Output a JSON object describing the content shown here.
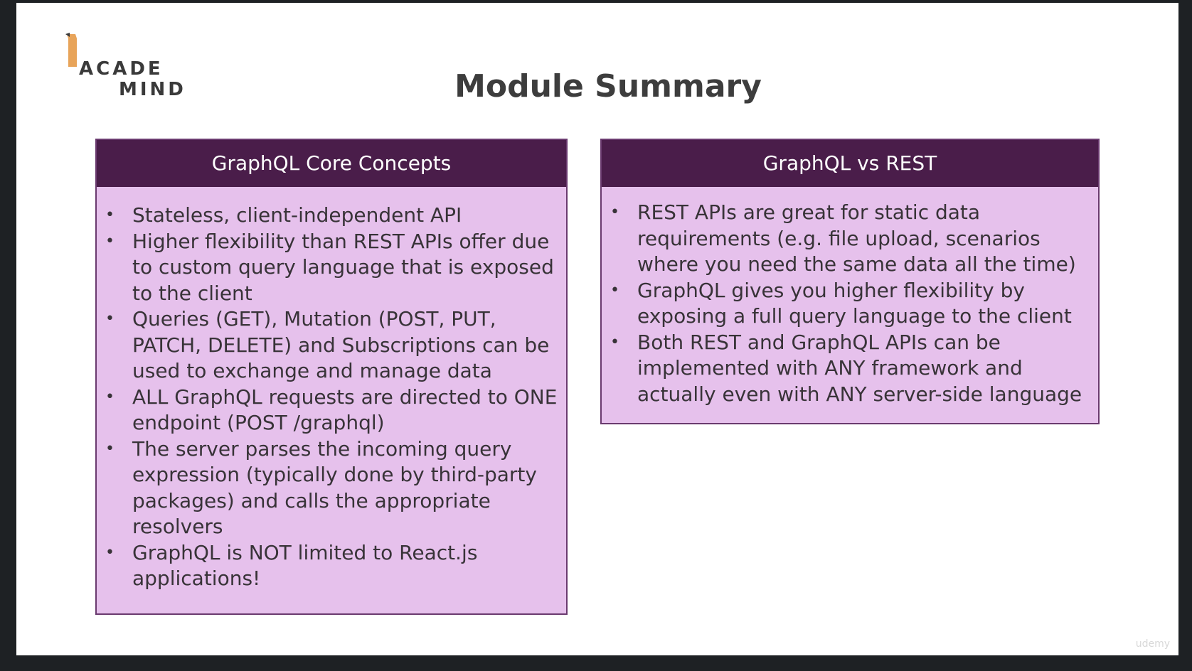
{
  "logo": {
    "line1": "ACADE",
    "line2": "MIND",
    "accent_color": "#e8a45a"
  },
  "slide": {
    "title": "Module Summary"
  },
  "cards": {
    "left": {
      "header": "GraphQL Core Concepts",
      "items": [
        "Stateless, client-independent API",
        "Higher flexibility than REST APIs offer due to custom query language that is exposed to the client",
        "Queries (GET), Mutation (POST, PUT, PATCH, DELETE) and Subscriptions can be used to exchange and manage data",
        "ALL GraphQL requests are directed to ONE endpoint (POST /graphql)",
        "The server parses the incoming query expression (typically done by third-party packages) and calls the appropriate resolvers",
        "GraphQL is NOT limited to React.js applications!"
      ]
    },
    "right": {
      "header": "GraphQL vs REST",
      "items": [
        "REST APIs are great for static data requirements (e.g. file upload, scenarios where you need the same data all the time)",
        "GraphQL gives you higher flexibility by exposing a full query language to the client",
        "Both REST and GraphQL APIs can be implemented with ANY framework and actually even with ANY server-side language"
      ]
    }
  },
  "watermark": "udemy",
  "colors": {
    "header_bg": "#4a1d4a",
    "card_bg": "#e6c1ec",
    "frame_bg": "#1e2124"
  }
}
